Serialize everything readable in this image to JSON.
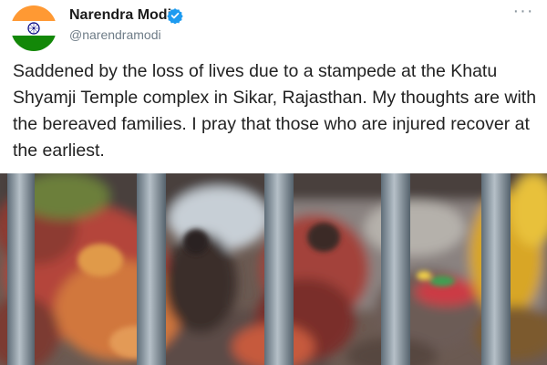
{
  "tweet": {
    "author": {
      "name": "Narendra Modi",
      "handle": "@narendramodi",
      "verified": true,
      "avatar_icon": "indian-flag-icon"
    },
    "more_icon": "more-options-icon",
    "more_label": "···",
    "text": "Saddened by the loss of lives due to a stampede at the Khatu Shyamji Temple complex in Sikar, Rajasthan. My thoughts are with the bereaved families. I pray that those who are injured recover at the earliest.",
    "media": {
      "type": "photo"
    }
  },
  "colors": {
    "verified": "#1d9bf0",
    "saffron": "#ff9933",
    "green": "#138808",
    "chakra": "#000080",
    "handle_text": "#6e7c87"
  }
}
